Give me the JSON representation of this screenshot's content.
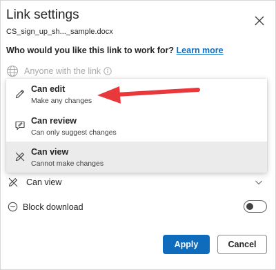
{
  "dialog": {
    "title": "Link settings",
    "filename": "CS_sign_up_sh..._sample.docx",
    "question": "Who would you like this link to work for?",
    "learn_more": "Learn more"
  },
  "audience": {
    "label": "Anyone with the link"
  },
  "permission_menu": {
    "options": [
      {
        "title": "Can edit",
        "subtitle": "Make any changes"
      },
      {
        "title": "Can review",
        "subtitle": "Can only suggest changes"
      },
      {
        "title": "Can view",
        "subtitle": "Cannot make changes"
      }
    ],
    "selected_index": 2
  },
  "permission_select": {
    "value": "Can view"
  },
  "block_download": {
    "label": "Block download",
    "enabled": false
  },
  "buttons": {
    "apply": "Apply",
    "cancel": "Cancel"
  },
  "colors": {
    "accent": "#0f6cbd",
    "annotation_arrow": "#e8383c",
    "selected_row": "#ebebeb"
  },
  "icons": {
    "close": "close-icon",
    "globe": "globe-icon",
    "info": "info-icon",
    "edit": "pencil-icon",
    "review": "review-icon",
    "view": "no-edit-icon",
    "chevron": "chevron-down-icon",
    "block": "block-icon"
  }
}
